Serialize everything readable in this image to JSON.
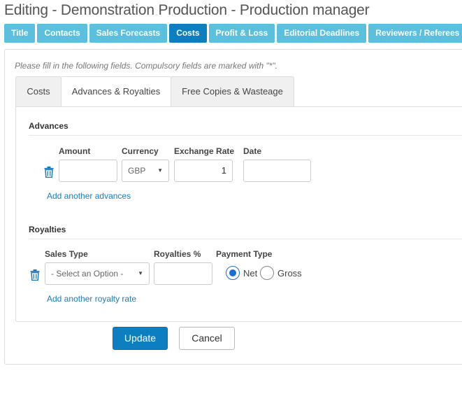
{
  "page": {
    "title": "Editing - Demonstration Production - Production manager"
  },
  "main_tabs": [
    {
      "label": "Title",
      "active": false
    },
    {
      "label": "Contacts",
      "active": false
    },
    {
      "label": "Sales Forecasts",
      "active": false
    },
    {
      "label": "Costs",
      "active": true
    },
    {
      "label": "Profit & Loss",
      "active": false
    },
    {
      "label": "Editorial Deadlines",
      "active": false
    },
    {
      "label": "Reviewers / Referees",
      "active": false
    }
  ],
  "form": {
    "hint": "Please fill in the following fields. Compulsory fields are marked with \"*\".",
    "sub_tabs": [
      {
        "label": "Costs",
        "active": false
      },
      {
        "label": "Advances & Royalties",
        "active": true
      },
      {
        "label": "Free Copies & Wasteage",
        "active": false
      }
    ],
    "advances": {
      "title": "Advances",
      "columns": {
        "amount": "Amount",
        "currency": "Currency",
        "exchange_rate": "Exchange Rate",
        "date": "Date"
      },
      "row": {
        "amount": "",
        "currency": "GBP",
        "exchange_rate": "1",
        "date": ""
      },
      "add_link": "Add another advances"
    },
    "royalties": {
      "title": "Royalties",
      "columns": {
        "sales_type": "Sales Type",
        "royalties_pct": "Royalties %",
        "payment_type": "Payment Type"
      },
      "row": {
        "sales_type": "- Select an Option -",
        "royalties_pct": "",
        "payment_type": "Net"
      },
      "payment_options": [
        "Net",
        "Gross"
      ],
      "add_link": "Add another royalty rate"
    },
    "buttons": {
      "update": "Update",
      "cancel": "Cancel"
    }
  },
  "icons": {
    "delete": "trash-icon",
    "dropdown": "caret-down-icon"
  },
  "colors": {
    "tab": "#5bc0de",
    "tab_active": "#0d7fc1",
    "link": "#1a7bc1",
    "primary": "#0d7fc1"
  }
}
